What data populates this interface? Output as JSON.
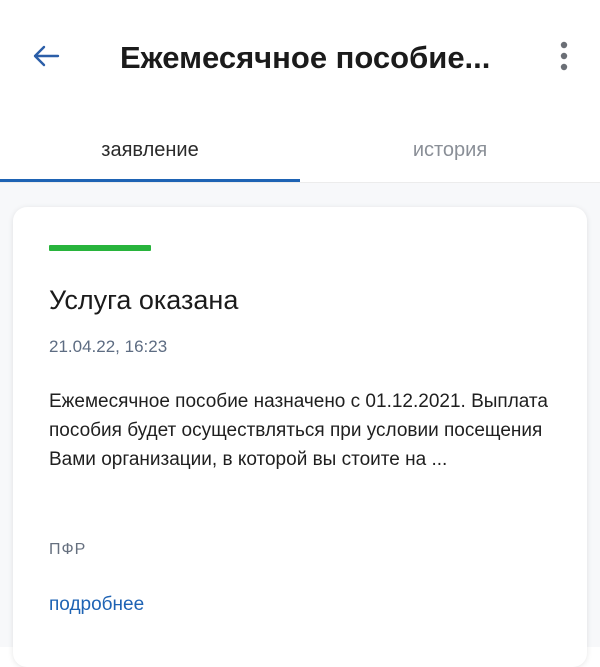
{
  "header": {
    "title": "Ежемесячное пособие...",
    "back_icon": "arrow-left-icon",
    "menu_icon": "more-vertical-icon"
  },
  "tabs": [
    {
      "label": "заявление",
      "active": true
    },
    {
      "label": "история",
      "active": false
    }
  ],
  "card": {
    "status_color": "#28b43c",
    "status_title": "Услуга оказана",
    "date": "21.04.22, 16:23",
    "description": "Ежемесячное пособие назначено с 01.12.2021. Выплата пособия будет осуществляться при условии посещения Вами организации, в которой вы стоите на ...",
    "organization": "ПФР",
    "more_link": "подробнее"
  },
  "colors": {
    "accent": "#1e63b4",
    "status_success": "#28b43c"
  }
}
